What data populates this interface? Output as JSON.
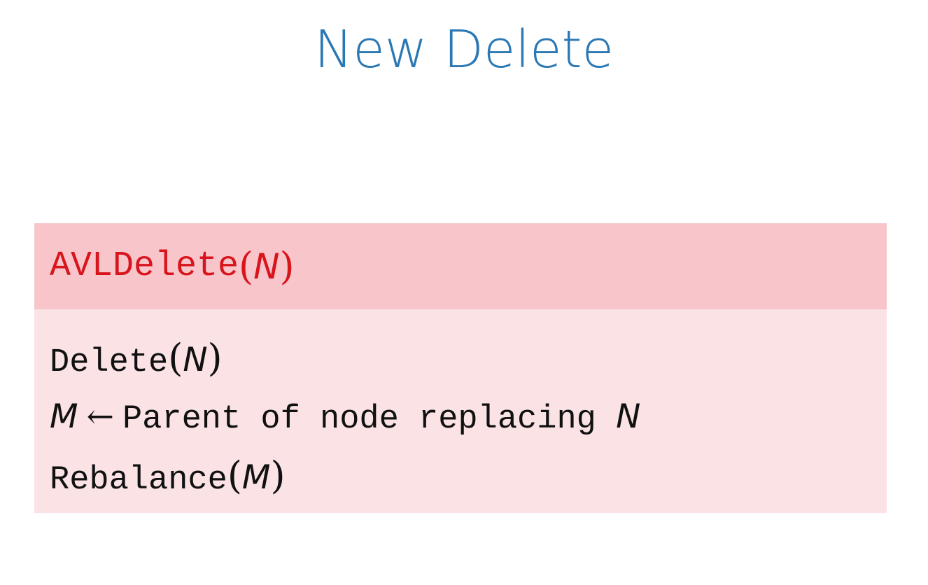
{
  "slide": {
    "title": "New Delete",
    "block": {
      "header": {
        "name": "AVLDelete",
        "arg": "N"
      },
      "lines": [
        {
          "fn": "Delete",
          "arg": "N"
        },
        {
          "var": "M",
          "arrow": "←",
          "text": "Parent of node replacing ",
          "var2": "N"
        },
        {
          "fn": "Rebalance",
          "arg": "M"
        }
      ]
    },
    "colors": {
      "title": "#2a78b4",
      "header_text": "#d8141c",
      "header_bg": "#f7c5ca",
      "body_bg": "#fae2e5"
    }
  }
}
